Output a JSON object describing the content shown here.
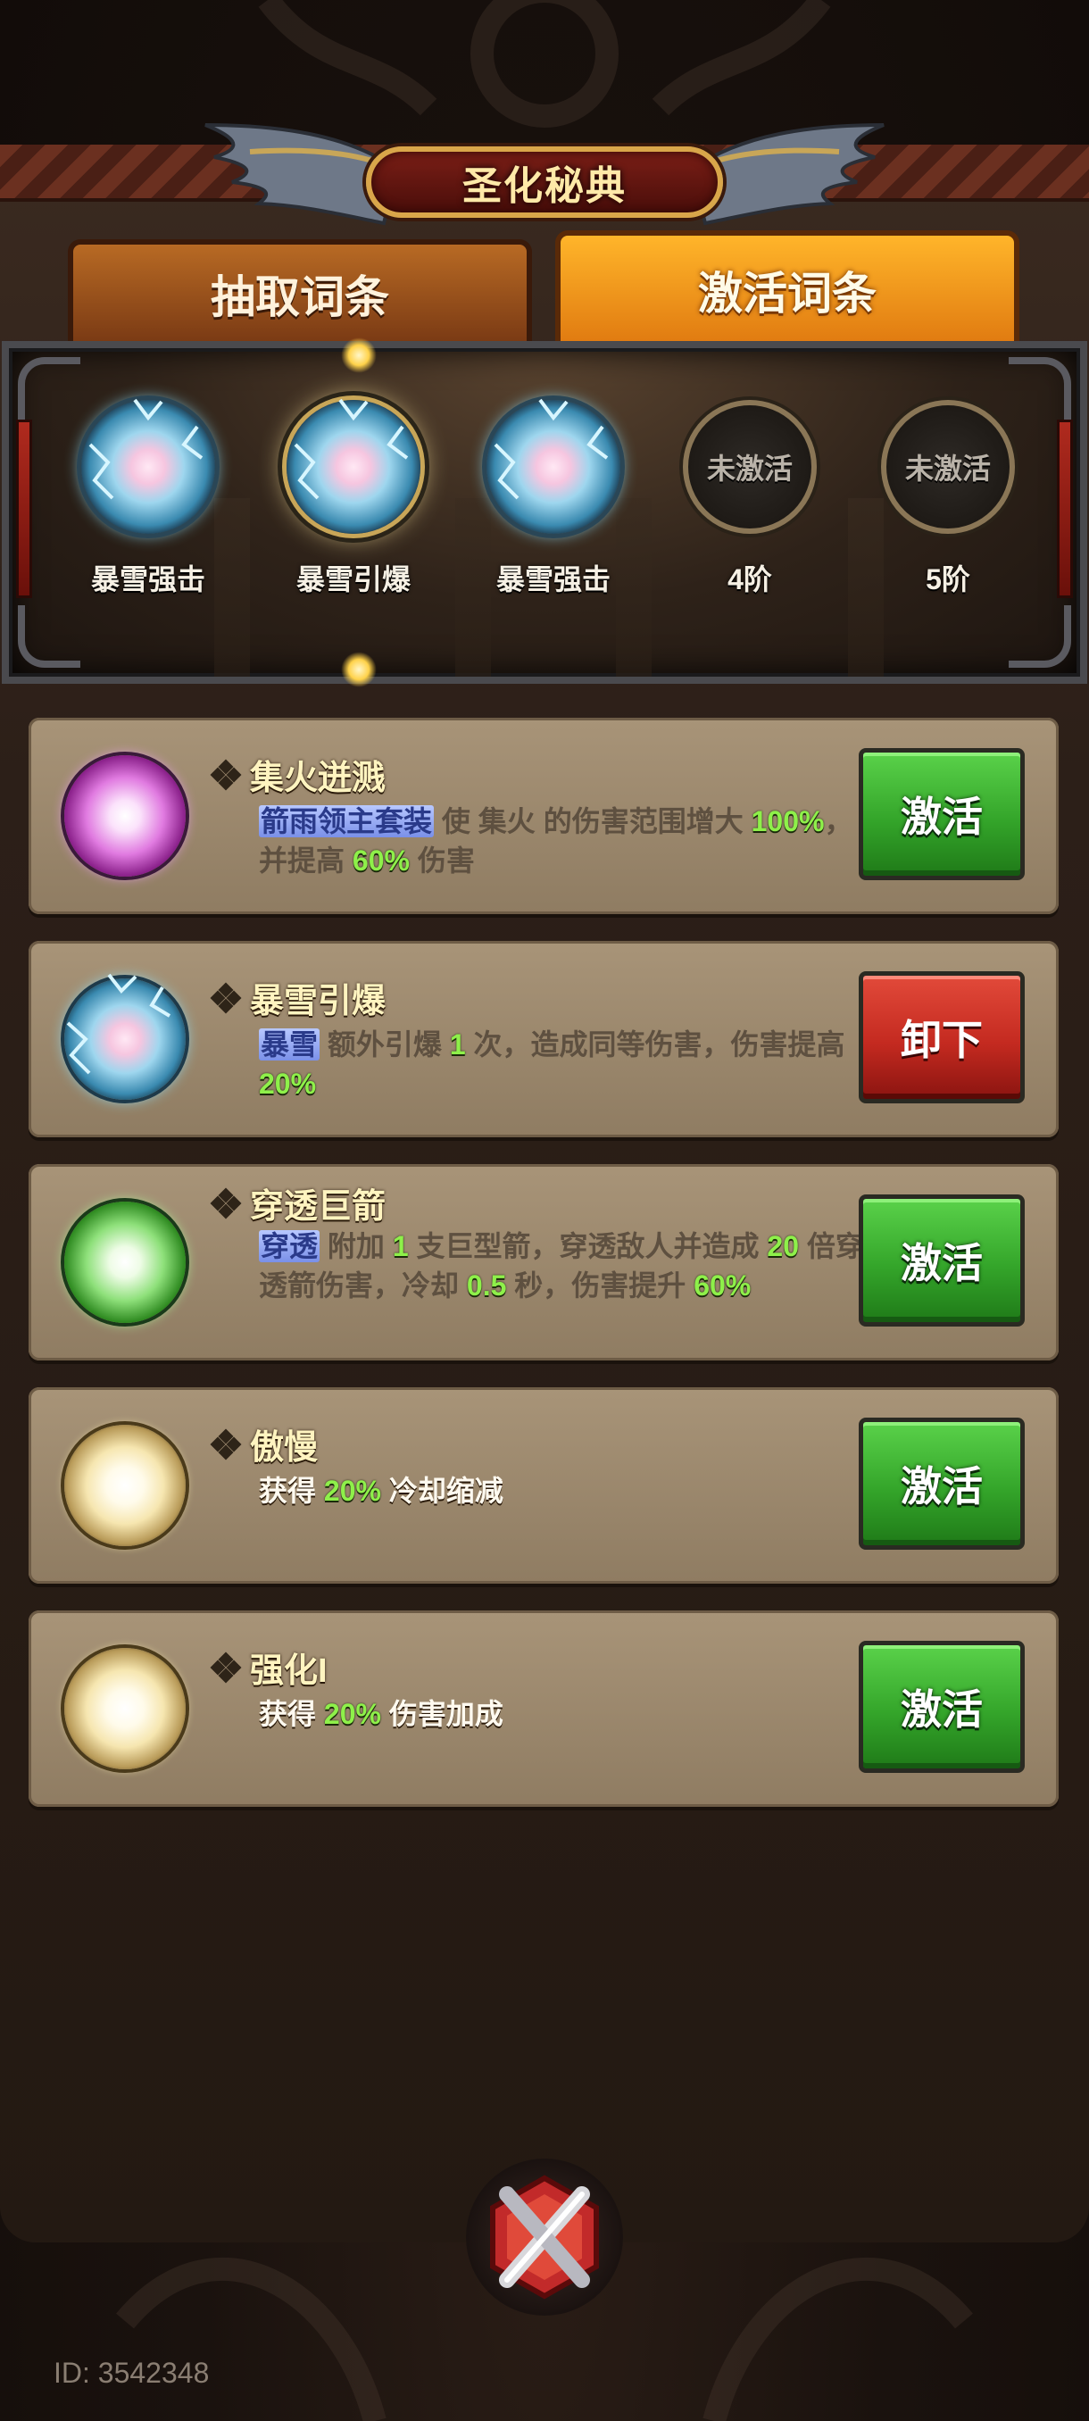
{
  "header": {
    "title": "圣化秘典"
  },
  "tabs": [
    {
      "label": "抽取词条",
      "active": false
    },
    {
      "label": "激活词条",
      "active": true
    }
  ],
  "slots": [
    {
      "label": "暴雪强击",
      "state": "equipped",
      "icon": "ice-orb"
    },
    {
      "label": "暴雪引爆",
      "state": "equipped-selected",
      "icon": "ice-orb"
    },
    {
      "label": "暴雪强击",
      "state": "equipped",
      "icon": "ice-orb"
    },
    {
      "label": "4阶",
      "state": "locked",
      "icon_text": "未激活"
    },
    {
      "label": "5阶",
      "state": "locked",
      "icon_text": "未激活"
    }
  ],
  "affixes": [
    {
      "name": "集火迸溅",
      "icon": "pink-orb",
      "button": "激活",
      "desc": {
        "keyword": "箭雨领主套装",
        "t1": " 使 集火 的伤害范围增大 ",
        "n1": "100%",
        "t2": "，并提高 ",
        "n2": "60%",
        "t3": " 伤害"
      }
    },
    {
      "name": "暴雪引爆",
      "icon": "ice-orb",
      "button": "卸下",
      "desc": {
        "keyword": "暴雪",
        "t1": " 额外引爆 ",
        "n1": "1",
        "t2": " 次，造成同等伤害，伤害提高 ",
        "n2": "20%"
      }
    },
    {
      "name": "穿透巨箭",
      "icon": "green-orb",
      "button": "激活",
      "desc": {
        "keyword": "穿透",
        "t1": " 附加 ",
        "n1": "1",
        "t2": " 支巨型箭，穿透敌人并造成 ",
        "n2": "20",
        "t3": " 倍穿透箭伤害，冷却 ",
        "n3": "0.5",
        "t4": " 秒，伤害提升 ",
        "n4": "60%"
      }
    },
    {
      "name": "傲慢",
      "icon": "gold-orb",
      "button": "激活",
      "desc": {
        "t1": "获得 ",
        "n1": "20%",
        "t2": " 冷却缩减"
      }
    },
    {
      "name": "强化I",
      "icon": "gold-orb",
      "button": "激活",
      "desc": {
        "t1": "获得 ",
        "n1": "20%",
        "t2": " 伤害加成"
      }
    }
  ],
  "footer": {
    "id_text": "ID: 3542348"
  },
  "colors": {
    "accent_orange": "#f0921a",
    "activate_green": "#34a52a",
    "unequip_red": "#c42a20",
    "number_green": "#8ef04a",
    "keyword_blue": "#7a90e8"
  }
}
